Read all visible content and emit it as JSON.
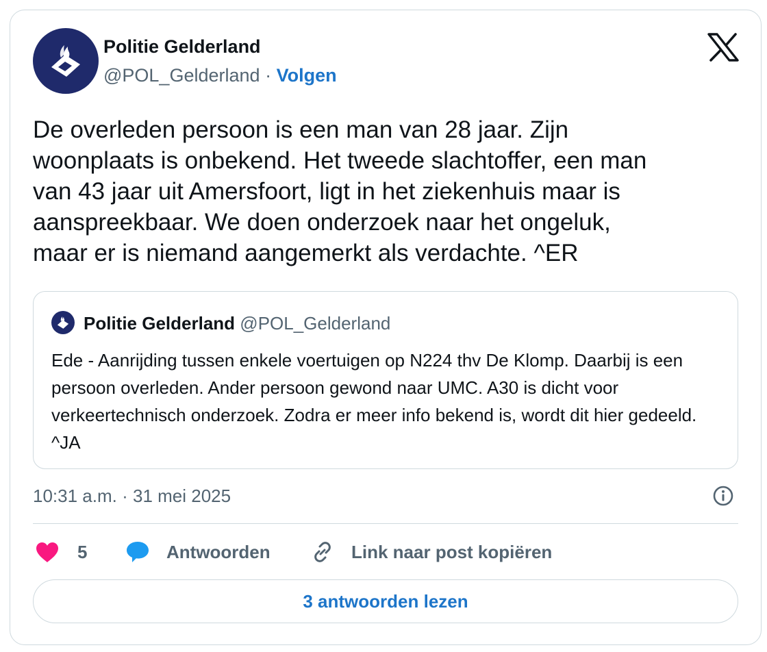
{
  "author": {
    "name": "Politie Gelderland",
    "handle": "@POL_Gelderland",
    "separator": "·",
    "follow_label": "Volgen",
    "avatar_icon": "police-logo-icon"
  },
  "platform_icon": "x-logo-icon",
  "tweet": {
    "text": "De overleden persoon is een man van 28 jaar. Zijn\nwoonplaats is onbekend. Het tweede slachtoffer, een man\nvan 43 jaar uit Amersfoort, ligt in het ziekenhuis maar is\naanspreekbaar. We doen onderzoek naar het ongeluk,\nmaar er is niemand aangemerkt als verdachte. ^ER"
  },
  "quoted": {
    "name": "Politie Gelderland",
    "handle": "@POL_Gelderland",
    "text": "Ede - Aanrijding tussen enkele voertuigen op N224 thv De Klomp. Daarbij is  een persoon overleden. Ander persoon gewond naar UMC. A30 is dicht voor verkeertechnisch onderzoek. Zodra er meer info bekend is, wordt dit hier gedeeld. ^JA"
  },
  "meta": {
    "time": "10:31 a.m.",
    "separator": "·",
    "date": "31 mei 2025"
  },
  "actions": {
    "like_count": "5",
    "reply_label": "Antwoorden",
    "copy_label": "Link naar post kopiëren"
  },
  "read_replies_label": "3 antwoorden lezen",
  "colors": {
    "accent": "#1d75c9",
    "like": "#f91880",
    "reply": "#1d9bf0",
    "avatar_bg": "#1f2a6b",
    "muted": "#536471",
    "border": "#cfd9de"
  }
}
